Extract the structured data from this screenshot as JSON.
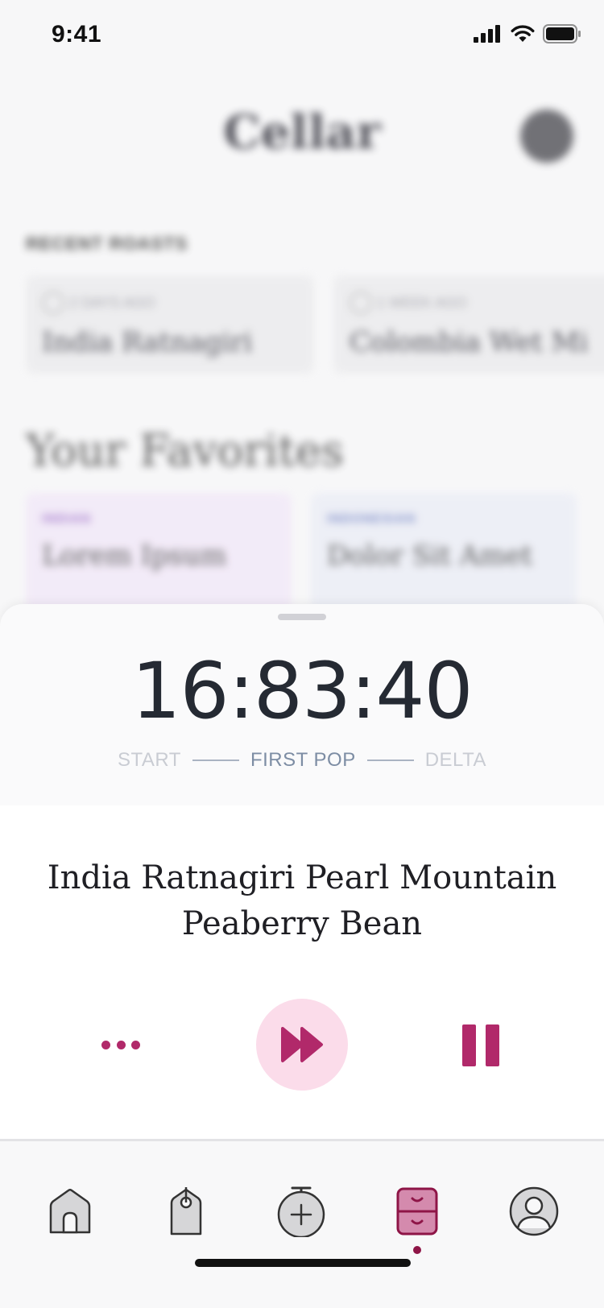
{
  "status_bar": {
    "time": "9:41",
    "icons": [
      "signal-icon",
      "wifi-icon",
      "battery-icon"
    ]
  },
  "background": {
    "app_title": "Cellar",
    "recent_label": "RECENT ROASTS",
    "recent_roasts": [
      {
        "meta": "2 DAYS AGO",
        "name": "India Ratnagiri"
      },
      {
        "meta": "1 WEEK AGO",
        "name": "Colombia Wet Mi"
      }
    ],
    "favorites_title": "Your Favorites",
    "favorites": [
      {
        "origin": "INDIAN",
        "name": "Lorem Ipsum",
        "origin_color": "#9b6cc7",
        "bg": "#f2e9f8"
      },
      {
        "origin": "INDONESIAN",
        "name": "Dolor Sit Amet",
        "origin_color": "#7283c4",
        "bg": "#eceef6"
      }
    ]
  },
  "roast_sheet": {
    "timer": "16:83:40",
    "phases": [
      {
        "label": "START",
        "active": false
      },
      {
        "label": "FIRST POP",
        "active": true
      },
      {
        "label": "DELTA",
        "active": false
      }
    ],
    "bean_name": "India Ratnagiri Pearl Mountain Peaberry Bean",
    "controls": {
      "more": "more-icon",
      "fast_forward": "fast-forward-icon",
      "pause": "pause-icon"
    }
  },
  "tab_bar": {
    "tabs": [
      {
        "name": "home",
        "icon": "home-icon",
        "active": false
      },
      {
        "name": "tags",
        "icon": "tag-icon",
        "active": false
      },
      {
        "name": "new-roast",
        "icon": "stopwatch-plus-icon",
        "active": false
      },
      {
        "name": "cellar",
        "icon": "cabinet-icon",
        "active": true
      },
      {
        "name": "profile",
        "icon": "profile-icon",
        "active": false
      }
    ]
  },
  "colors": {
    "accent": "#b1296a",
    "accent_dark": "#8e1547",
    "accent_light": "#fbdcea",
    "timer_text": "#252a33",
    "phase_active": "#7d8da4",
    "phase_inactive": "#c9ccd3"
  }
}
